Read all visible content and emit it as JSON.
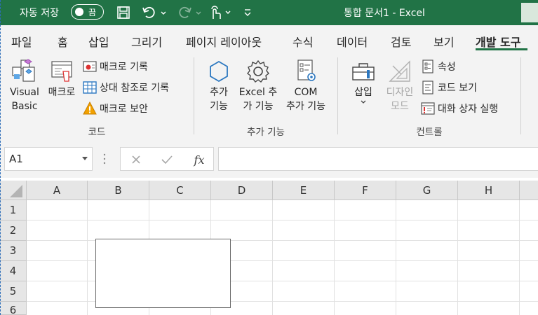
{
  "titlebar": {
    "autosave_label": "자동 저장",
    "autosave_state": "끔",
    "doc_title": "통합 문서1  -  Excel"
  },
  "tabs": [
    "파일",
    "홈",
    "삽입",
    "그리기",
    "페이지 레이아웃",
    "수식",
    "데이터",
    "검토",
    "보기",
    "개발 도구"
  ],
  "active_tab": "개발 도구",
  "ribbon": {
    "code": {
      "visual_basic_line1": "Visual",
      "visual_basic_line2": "Basic",
      "macro": "매크로",
      "record_macro": "매크로 기록",
      "relative_ref": "상대 참조로 기록",
      "macro_security": "매크로 보안",
      "group_label": "코드"
    },
    "addins": {
      "addins_line1": "추가",
      "addins_line2": "기능",
      "excel_addins_line1": "Excel 추",
      "excel_addins_line2": "가 기능",
      "com_addins_line1": "COM",
      "com_addins_line2": "추가 기능",
      "group_label": "추가 기능"
    },
    "controls": {
      "insert": "삽입",
      "design_line1": "디자인",
      "design_line2": "모드",
      "properties": "속성",
      "view_code": "코드 보기",
      "run_dialog": "대화 상자 실행",
      "group_label": "컨트롤"
    }
  },
  "formula_bar": {
    "name_box": "A1",
    "fx_label": "fx",
    "formula": ""
  },
  "grid": {
    "columns": [
      "A",
      "B",
      "C",
      "D",
      "E",
      "F",
      "G",
      "H"
    ],
    "rows": [
      "1",
      "2",
      "3",
      "4",
      "5",
      "6"
    ]
  },
  "colors": {
    "title_green": "#217346",
    "ribbon_bg": "#f3f3f3",
    "warning": "#f2a100"
  }
}
